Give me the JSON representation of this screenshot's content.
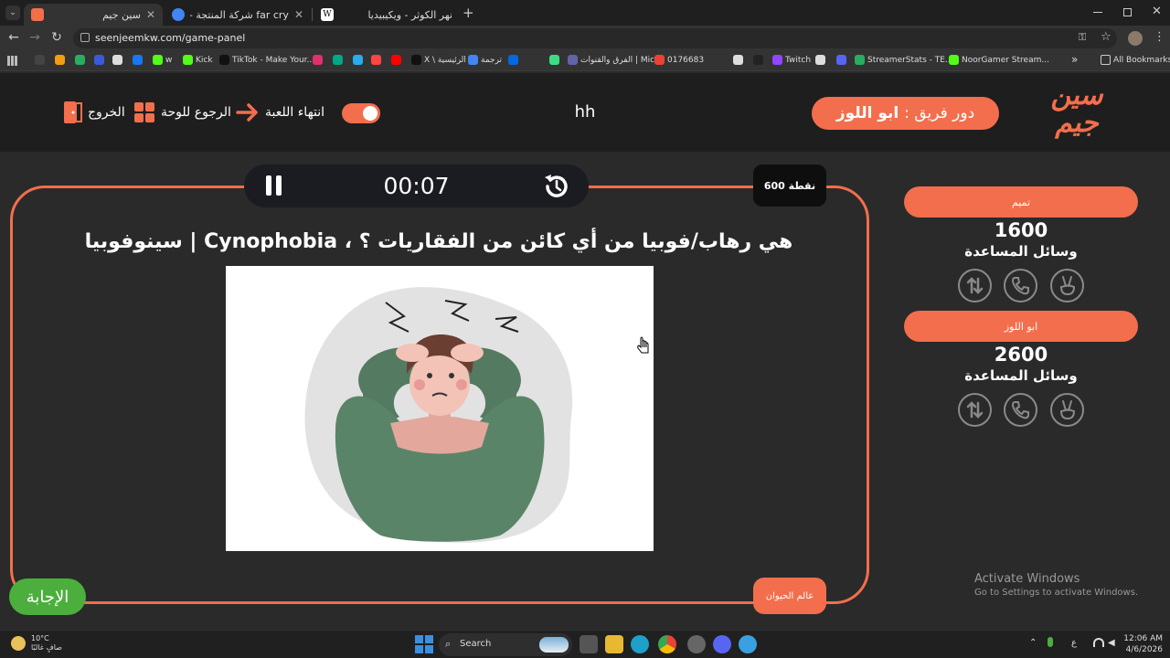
{
  "browser": {
    "tabs": [
      {
        "title": "سين جيم",
        "active": true,
        "favicon_color": "#f36e4c"
      },
      {
        "title": "far cry شركة المنتجة - بحث Google",
        "active": false,
        "favicon_color": "#4285f4"
      },
      {
        "title": "نهر الكوثر - ويكيبيديا",
        "active": false,
        "favicon_color": "#ffffff"
      }
    ],
    "new_tab_label": "+",
    "url": "seenjeemkw.com/game-panel",
    "bookmarks": [
      {
        "label": "",
        "color": "#444444"
      },
      {
        "label": "",
        "color": "#f39c12"
      },
      {
        "label": "",
        "color": "#27ae60"
      },
      {
        "label": "",
        "color": "#3a5bd9"
      },
      {
        "label": "",
        "color": "#dddddd"
      },
      {
        "label": "",
        "color": "#1877f2"
      },
      {
        "label": "w",
        "color": "#53fc18"
      },
      {
        "label": "Kick",
        "color": "#53fc18"
      },
      {
        "label": "TikTok - Make Your...",
        "color": "#111111"
      },
      {
        "label": "",
        "color": "#e1306c"
      },
      {
        "label": "",
        "color": "#00a884"
      },
      {
        "label": "",
        "color": "#2aabee"
      },
      {
        "label": "",
        "color": "#ff4444"
      },
      {
        "label": "",
        "color": "#ff0000"
      },
      {
        "label": "X \\ الرئيسية",
        "color": "#111111"
      },
      {
        "label": "ترجمة",
        "color": "#4285f4"
      },
      {
        "label": "",
        "color": "#0668e1"
      },
      {
        "label": "",
        "color": "#3ddc84"
      },
      {
        "label": "الفرق والقنوات | Micr...",
        "color": "#6264a7"
      },
      {
        "label": "0176683",
        "color": "#ea4335"
      },
      {
        "label": "",
        "color": "#dddddd"
      },
      {
        "label": "",
        "color": "#222222"
      },
      {
        "label": "Twitch",
        "color": "#9146ff"
      },
      {
        "label": "",
        "color": "#dddddd"
      },
      {
        "label": "",
        "color": "#5865f2"
      },
      {
        "label": "StreamerStats - TE...",
        "color": "#27ae60"
      },
      {
        "label": "NoorGamer Stream...",
        "color": "#53fc18"
      }
    ],
    "more_bookmarks": "»",
    "all_bookmarks": "All Bookmarks"
  },
  "header": {
    "exit_label": "الخروج",
    "back_to_board_label": "الرجوع للوحة",
    "end_game_label": "انتهاء اللعبة",
    "game_name": "hh",
    "team_turn_prefix": "دور فريق :",
    "team_turn_name": "ابو اللوز",
    "logo_line1": "سين",
    "logo_line2": "جيم"
  },
  "board": {
    "timer": "00:07",
    "points": "600 نقطة",
    "question": "سينوفوبيا | Cynophobia ، هي رهاب/فوبيا من أي كائن من الفقاريات ؟",
    "category": "عالم الحيوان",
    "answer_button": "الإجابة"
  },
  "teams": [
    {
      "name": "تميم",
      "score": "1600",
      "aids_label": "وسائل المساعدة"
    },
    {
      "name": "ابو اللوز",
      "score": "2600",
      "aids_label": "وسائل المساعدة"
    }
  ],
  "watermark": {
    "line1": "Activate Windows",
    "line2": "Go to Settings to activate Windows."
  },
  "taskbar": {
    "temperature": "10°C",
    "weather_desc": "صافٍ غالبًا",
    "search_label": "Search",
    "lang": "ع",
    "time": "12:06 AM",
    "date": "4/6/2026"
  },
  "colors": {
    "accent": "#f36e4c",
    "answer_green": "#4caf3d",
    "page_bg": "#2a2a2a",
    "header_bg": "#1e1e1e"
  }
}
